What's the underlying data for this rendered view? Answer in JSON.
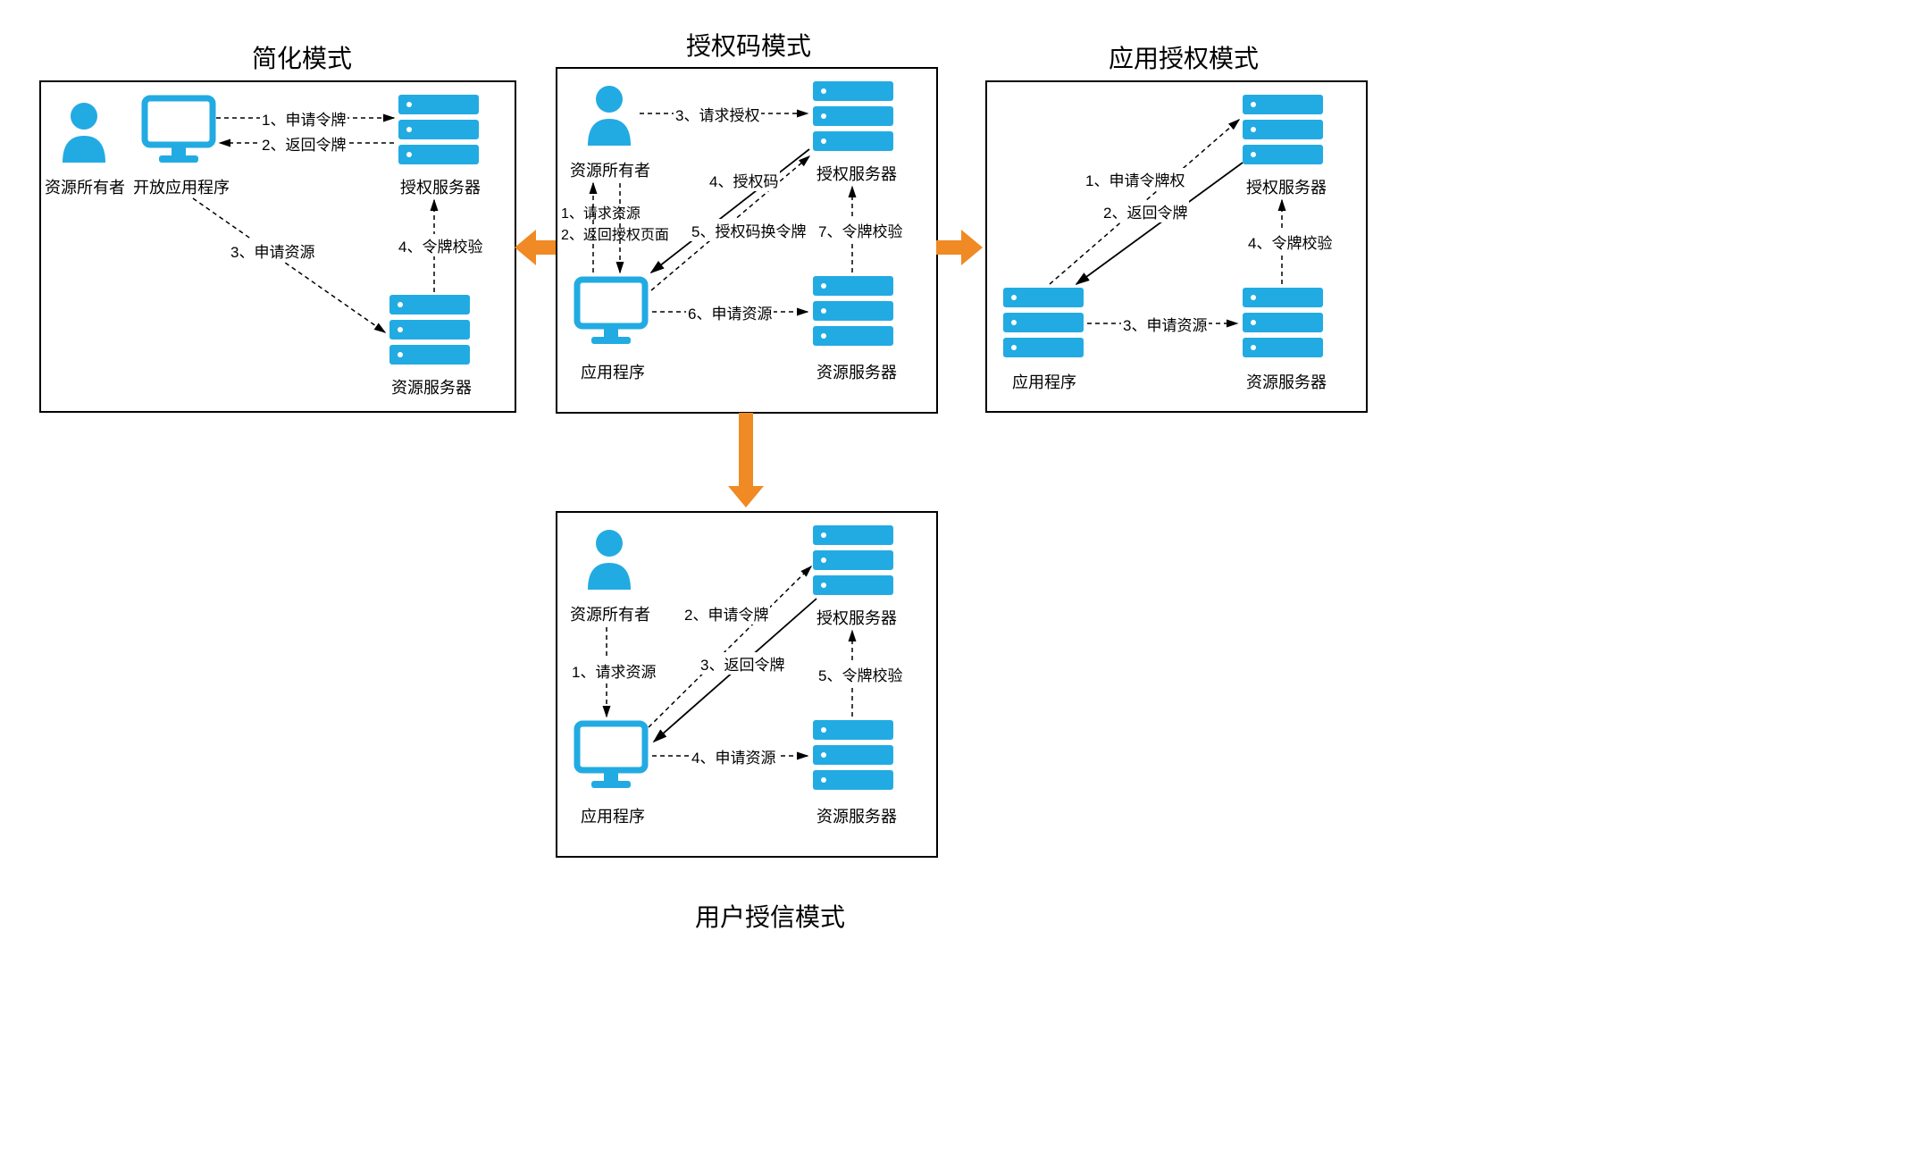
{
  "colors": {
    "accent": "#22abe2",
    "arrow": "#f08a24"
  },
  "titles": {
    "simplified": "简化模式",
    "authcode": "授权码模式",
    "appauth": "应用授权模式",
    "usercred": "用户授信模式"
  },
  "nodes": {
    "resourceOwner": "资源所有者",
    "openApp": "开放应用程序",
    "application": "应用程序",
    "authServer": "授权服务器",
    "resourceServer": "资源服务器"
  },
  "simplified": {
    "s1": "1、申请令牌",
    "s2": "2、返回令牌",
    "s3": "3、申请资源",
    "s4": "4、令牌校验"
  },
  "authcode": {
    "a1": "1、请求资源",
    "a2": "2、返回授权页面",
    "a3": "3、请求授权",
    "a4": "4、授权码",
    "a5": "5、授权码换令牌",
    "a6": "6、申请资源",
    "a7": "7、令牌校验"
  },
  "appauth": {
    "p1": "1、申请令牌权",
    "p2": "2、返回令牌",
    "p3": "3、申请资源",
    "p4": "4、令牌校验"
  },
  "usercred": {
    "u1": "1、请求资源",
    "u2": "2、申请令牌",
    "u3": "3、返回令牌",
    "u4": "4、申请资源",
    "u5": "5、令牌校验"
  }
}
